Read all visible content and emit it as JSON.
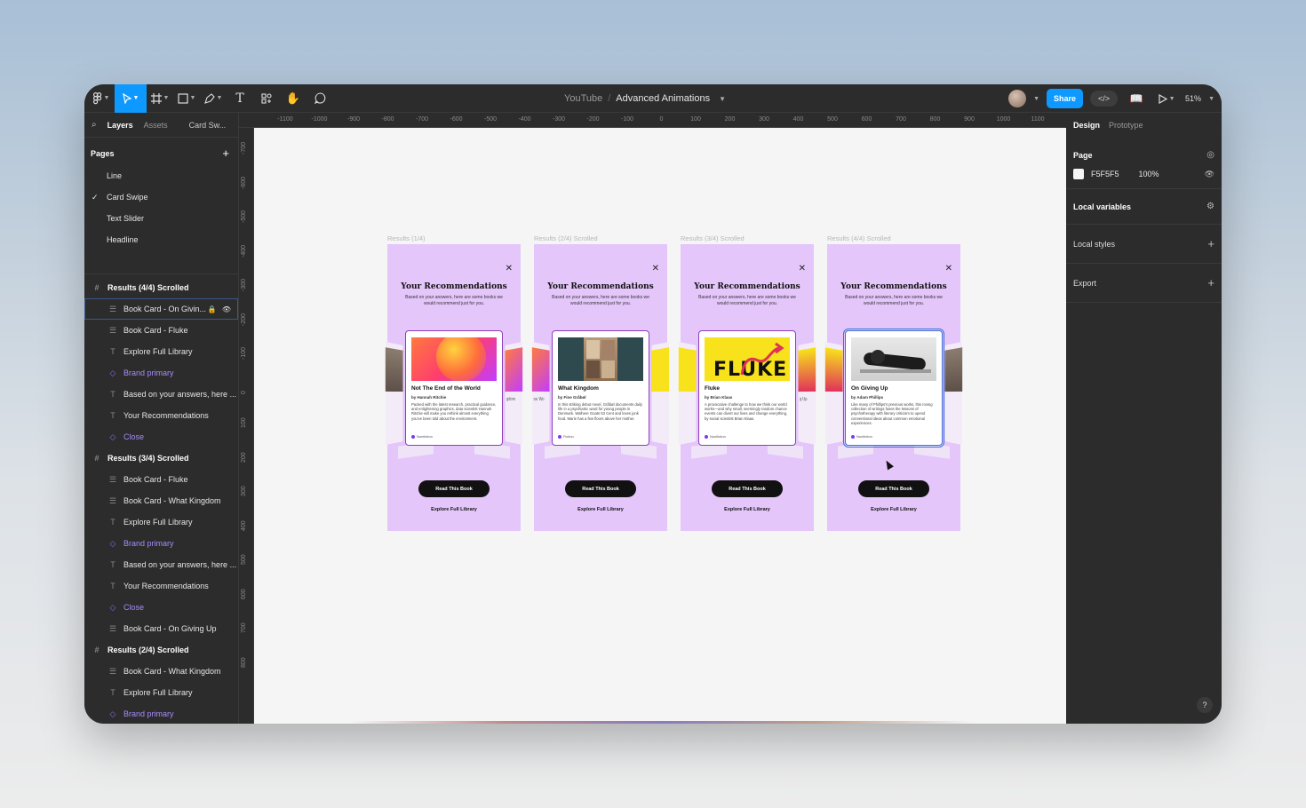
{
  "toolbar": {
    "project": "YouTube",
    "separator": "/",
    "file": "Advanced Animations",
    "share_label": "Share",
    "code_label": "</>",
    "zoom": "51%",
    "tools": [
      "figma-menu-icon",
      "move-tool-icon",
      "frame-tool-icon",
      "rectangle-tool-icon",
      "pen-tool-icon",
      "text-tool-icon",
      "resources-icon",
      "hand-tool-icon",
      "comment-tool-icon"
    ]
  },
  "left_panel": {
    "tabs": {
      "layers": "Layers",
      "assets": "Assets",
      "page": "Card Sw..."
    },
    "pages_title": "Pages",
    "pages": [
      {
        "name": "Line",
        "checked": false
      },
      {
        "name": "Card Swipe",
        "checked": true
      },
      {
        "name": "Text Slider",
        "checked": false
      },
      {
        "name": "Headline",
        "checked": false
      }
    ],
    "layers": [
      {
        "name": "Results (4/4) Scrolled",
        "type": "frame"
      },
      {
        "name": "Book Card - On Givin...",
        "type": "component",
        "selected": true
      },
      {
        "name": "Book Card - Fluke",
        "type": "component"
      },
      {
        "name": "Explore Full Library",
        "type": "text"
      },
      {
        "name": "Brand primary",
        "type": "instance"
      },
      {
        "name": "Based on your answers, here ...",
        "type": "text"
      },
      {
        "name": "Your Recommendations",
        "type": "text"
      },
      {
        "name": "Close",
        "type": "instance"
      },
      {
        "name": "Results (3/4) Scrolled",
        "type": "frame"
      },
      {
        "name": "Book Card - Fluke",
        "type": "component"
      },
      {
        "name": "Book Card - What Kingdom",
        "type": "component"
      },
      {
        "name": "Explore Full Library",
        "type": "text"
      },
      {
        "name": "Brand primary",
        "type": "instance"
      },
      {
        "name": "Based on your answers, here ...",
        "type": "text"
      },
      {
        "name": "Your Recommendations",
        "type": "text"
      },
      {
        "name": "Close",
        "type": "instance"
      },
      {
        "name": "Book Card - On Giving Up",
        "type": "component"
      },
      {
        "name": "Results (2/4) Scrolled",
        "type": "frame"
      },
      {
        "name": "Book Card - What Kingdom",
        "type": "component"
      },
      {
        "name": "Explore Full Library",
        "type": "text"
      },
      {
        "name": "Brand primary",
        "type": "instance"
      }
    ]
  },
  "rulers": {
    "top": [
      "-1100",
      "-1000",
      "-900",
      "-800",
      "-700",
      "-600",
      "-500",
      "-400",
      "-300",
      "-200",
      "-100",
      "0",
      "100",
      "200",
      "300",
      "400",
      "500",
      "600",
      "700",
      "800",
      "900",
      "1000",
      "1100"
    ],
    "left": [
      "-700",
      "-600",
      "-500",
      "-400",
      "-300",
      "-200",
      "-100",
      "0",
      "100",
      "200",
      "300",
      "400",
      "500",
      "600",
      "700",
      "800"
    ]
  },
  "canvas": {
    "frames": [
      {
        "label": "Results (1/4)",
        "title": "Your Recommendations",
        "subtitle": "Based on your answers, here are some books we would recommend just for you.",
        "book": {
          "title": "Not The End of the World",
          "author": "by Hannah Ritchie",
          "desc": "Packed with the latest research, practical guidance, and enlightening graphics, data scientist Hannah Ritchie will make you rethink almost everything you've been told about the environment.",
          "tag": "Nonfiction"
        },
        "left_peek": "",
        "right_peek": "gdom",
        "button": "Read This Book",
        "link": "Explore Full Library"
      },
      {
        "label": "Results (2/4) Scrolled",
        "title": "Your Recommendations",
        "subtitle": "Based on your answers, here are some books we would recommend just for you.",
        "book": {
          "title": "What Kingdom",
          "author": "by Fine Gråbøl",
          "desc": "In this striking debut novel, Gråbøl documents daily life in a psychiatric ward for young people in Denmark. Walhere Goats 53 Cent and loves junk food. Marie has a few floors above her mother.",
          "tag": "Fiction"
        },
        "left_peek": "ne Wo",
        "right_peek": "",
        "button": "Read This Book",
        "link": "Explore Full Library"
      },
      {
        "label": "Results (3/4) Scrolled",
        "title": "Your Recommendations",
        "subtitle": "Based on your answers, here are some books we would recommend just for you.",
        "book": {
          "title": "Fluke",
          "author": "by Brian Klaas",
          "desc": "A provocative challenge to how we think our world works—and why small, seemingly random chance events can divert our lives and change everything, by social scientist Brian Klaas.",
          "tag": "Nonfiction"
        },
        "left_peek": "",
        "right_peek": "g Up",
        "button": "Read This Book",
        "link": "Explore Full Library"
      },
      {
        "label": "Results (4/4) Scrolled",
        "title": "Your Recommendations",
        "subtitle": "Based on your answers, here are some books we would recommend just for you.",
        "book": {
          "title": "On Giving Up",
          "author": "by Adam Phillips",
          "desc": "Like many of Phillips's previous works, this roving collection of writings fuses the lessons of psychotherapy with literary criticism to upend conventional ideas about common emotional experiences.",
          "tag": "Nonfiction"
        },
        "left_peek": "",
        "right_peek": "",
        "button": "Read This Book",
        "link": "Explore Full Library"
      }
    ]
  },
  "right_panel": {
    "tabs": {
      "design": "Design",
      "prototype": "Prototype"
    },
    "page_title": "Page",
    "page_color": "F5F5F5",
    "page_opacity": "100%",
    "local_variables": "Local variables",
    "local_styles": "Local styles",
    "export": "Export",
    "help": "?"
  },
  "colors": {
    "accent": "#0d99ff",
    "frame_bg": "#e4c6fb",
    "card_border": "#8e3dbb",
    "selection": "#3b6fd8",
    "canvas": "#f5f5f5",
    "brand_purple": "#a78bfa"
  }
}
